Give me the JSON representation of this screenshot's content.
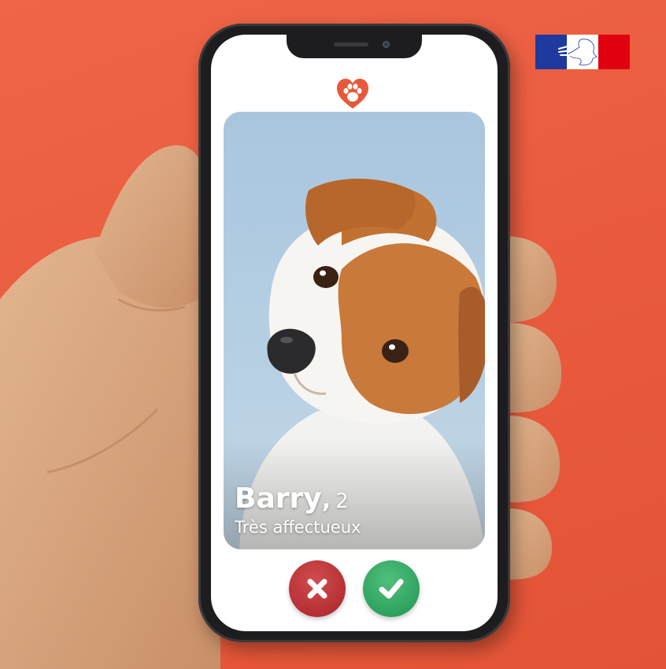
{
  "profile": {
    "name": "Barry",
    "comma": ",",
    "age": "2",
    "tagline": "Très affectueux"
  },
  "app": {
    "logo_icon": "heart-paw-icon"
  },
  "actions": {
    "reject_icon": "close-icon",
    "like_icon": "check-icon"
  },
  "colors": {
    "background": "#e95a3d",
    "brand": "#e8583a",
    "reject": "#b52f35",
    "like": "#2fa25f"
  }
}
